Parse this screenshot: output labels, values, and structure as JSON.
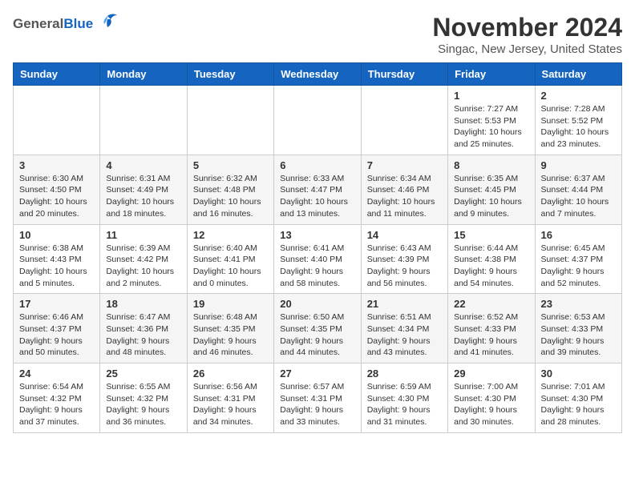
{
  "header": {
    "logo_general": "General",
    "logo_blue": "Blue",
    "month": "November 2024",
    "location": "Singac, New Jersey, United States"
  },
  "weekdays": [
    "Sunday",
    "Monday",
    "Tuesday",
    "Wednesday",
    "Thursday",
    "Friday",
    "Saturday"
  ],
  "weeks": [
    [
      {
        "day": "",
        "info": ""
      },
      {
        "day": "",
        "info": ""
      },
      {
        "day": "",
        "info": ""
      },
      {
        "day": "",
        "info": ""
      },
      {
        "day": "",
        "info": ""
      },
      {
        "day": "1",
        "info": "Sunrise: 7:27 AM\nSunset: 5:53 PM\nDaylight: 10 hours and 25 minutes."
      },
      {
        "day": "2",
        "info": "Sunrise: 7:28 AM\nSunset: 5:52 PM\nDaylight: 10 hours and 23 minutes."
      }
    ],
    [
      {
        "day": "3",
        "info": "Sunrise: 6:30 AM\nSunset: 4:50 PM\nDaylight: 10 hours and 20 minutes."
      },
      {
        "day": "4",
        "info": "Sunrise: 6:31 AM\nSunset: 4:49 PM\nDaylight: 10 hours and 18 minutes."
      },
      {
        "day": "5",
        "info": "Sunrise: 6:32 AM\nSunset: 4:48 PM\nDaylight: 10 hours and 16 minutes."
      },
      {
        "day": "6",
        "info": "Sunrise: 6:33 AM\nSunset: 4:47 PM\nDaylight: 10 hours and 13 minutes."
      },
      {
        "day": "7",
        "info": "Sunrise: 6:34 AM\nSunset: 4:46 PM\nDaylight: 10 hours and 11 minutes."
      },
      {
        "day": "8",
        "info": "Sunrise: 6:35 AM\nSunset: 4:45 PM\nDaylight: 10 hours and 9 minutes."
      },
      {
        "day": "9",
        "info": "Sunrise: 6:37 AM\nSunset: 4:44 PM\nDaylight: 10 hours and 7 minutes."
      }
    ],
    [
      {
        "day": "10",
        "info": "Sunrise: 6:38 AM\nSunset: 4:43 PM\nDaylight: 10 hours and 5 minutes."
      },
      {
        "day": "11",
        "info": "Sunrise: 6:39 AM\nSunset: 4:42 PM\nDaylight: 10 hours and 2 minutes."
      },
      {
        "day": "12",
        "info": "Sunrise: 6:40 AM\nSunset: 4:41 PM\nDaylight: 10 hours and 0 minutes."
      },
      {
        "day": "13",
        "info": "Sunrise: 6:41 AM\nSunset: 4:40 PM\nDaylight: 9 hours and 58 minutes."
      },
      {
        "day": "14",
        "info": "Sunrise: 6:43 AM\nSunset: 4:39 PM\nDaylight: 9 hours and 56 minutes."
      },
      {
        "day": "15",
        "info": "Sunrise: 6:44 AM\nSunset: 4:38 PM\nDaylight: 9 hours and 54 minutes."
      },
      {
        "day": "16",
        "info": "Sunrise: 6:45 AM\nSunset: 4:37 PM\nDaylight: 9 hours and 52 minutes."
      }
    ],
    [
      {
        "day": "17",
        "info": "Sunrise: 6:46 AM\nSunset: 4:37 PM\nDaylight: 9 hours and 50 minutes."
      },
      {
        "day": "18",
        "info": "Sunrise: 6:47 AM\nSunset: 4:36 PM\nDaylight: 9 hours and 48 minutes."
      },
      {
        "day": "19",
        "info": "Sunrise: 6:48 AM\nSunset: 4:35 PM\nDaylight: 9 hours and 46 minutes."
      },
      {
        "day": "20",
        "info": "Sunrise: 6:50 AM\nSunset: 4:35 PM\nDaylight: 9 hours and 44 minutes."
      },
      {
        "day": "21",
        "info": "Sunrise: 6:51 AM\nSunset: 4:34 PM\nDaylight: 9 hours and 43 minutes."
      },
      {
        "day": "22",
        "info": "Sunrise: 6:52 AM\nSunset: 4:33 PM\nDaylight: 9 hours and 41 minutes."
      },
      {
        "day": "23",
        "info": "Sunrise: 6:53 AM\nSunset: 4:33 PM\nDaylight: 9 hours and 39 minutes."
      }
    ],
    [
      {
        "day": "24",
        "info": "Sunrise: 6:54 AM\nSunset: 4:32 PM\nDaylight: 9 hours and 37 minutes."
      },
      {
        "day": "25",
        "info": "Sunrise: 6:55 AM\nSunset: 4:32 PM\nDaylight: 9 hours and 36 minutes."
      },
      {
        "day": "26",
        "info": "Sunrise: 6:56 AM\nSunset: 4:31 PM\nDaylight: 9 hours and 34 minutes."
      },
      {
        "day": "27",
        "info": "Sunrise: 6:57 AM\nSunset: 4:31 PM\nDaylight: 9 hours and 33 minutes."
      },
      {
        "day": "28",
        "info": "Sunrise: 6:59 AM\nSunset: 4:30 PM\nDaylight: 9 hours and 31 minutes."
      },
      {
        "day": "29",
        "info": "Sunrise: 7:00 AM\nSunset: 4:30 PM\nDaylight: 9 hours and 30 minutes."
      },
      {
        "day": "30",
        "info": "Sunrise: 7:01 AM\nSunset: 4:30 PM\nDaylight: 9 hours and 28 minutes."
      }
    ]
  ]
}
